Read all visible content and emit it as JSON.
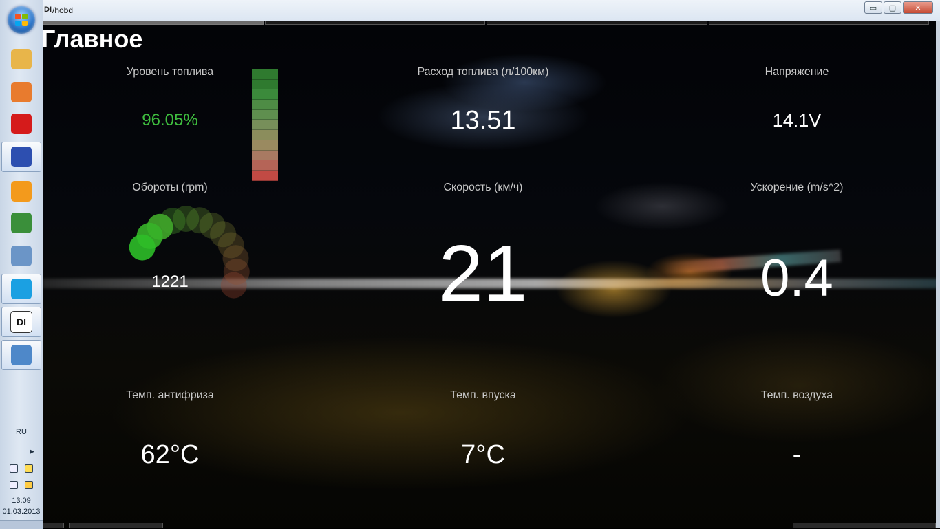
{
  "window": {
    "title": "/hobd",
    "app_mini": "DI",
    "min_glyph": "▭",
    "max_glyph": "▢",
    "close_glyph": "✕"
  },
  "taskbar": {
    "items": [
      {
        "name": "explorer-icon",
        "color": "#e8b54a"
      },
      {
        "name": "media-player-icon",
        "color": "#e87b2e"
      },
      {
        "name": "opera-icon",
        "color": "#d51b1b"
      },
      {
        "name": "save-icon",
        "color": "#2d4fb0"
      },
      {
        "name": "orange-app-icon",
        "color": "#f39a1c"
      },
      {
        "name": "chrome-icon",
        "color": "#3a8f3a"
      },
      {
        "name": "calculator-icon",
        "color": "#6b95c7"
      },
      {
        "name": "skype-icon",
        "color": "#1ba0e2"
      },
      {
        "name": "hobd-icon",
        "color": "#ffffff"
      },
      {
        "name": "paint-icon",
        "color": "#4e88c9"
      }
    ],
    "lang": "RU",
    "time": "13:09",
    "date": "01.03.2013"
  },
  "page": {
    "title": "Главное"
  },
  "tiles": {
    "fuel_level": {
      "label": "Уровень топлива",
      "value": "96.05%",
      "color": "#3fbe3f"
    },
    "fuel_consumption": {
      "label": "Расход топлива (л/100км)",
      "value": "13.51"
    },
    "voltage": {
      "label": "Напряжение",
      "value": "14.1V"
    },
    "rpm": {
      "label": "Обороты (rpm)",
      "value": "1221"
    },
    "speed": {
      "label": "Скорость (км/ч)",
      "value": "21"
    },
    "acceleration": {
      "label": "Ускорение (m/s^2)",
      "value": "0.4"
    },
    "coolant_temp": {
      "label": "Темп. антифриза",
      "value": "62°C"
    },
    "intake_temp": {
      "label": "Темп. впуска",
      "value": "7°C"
    },
    "air_temp": {
      "label": "Темп. воздуха",
      "value": "-"
    }
  },
  "fuel_bar": {
    "level_fraction": 0.9605,
    "segment_colors": [
      "#2f7a2f",
      "#2f7a2f",
      "#3b8a3b",
      "#4e8c45",
      "#5f8f4f",
      "#778f5a",
      "#8b8d5c",
      "#9a8a60",
      "#a87a62",
      "#b56457",
      "#c24a44"
    ]
  },
  "rpm_gauge": {
    "value": 1221
  }
}
